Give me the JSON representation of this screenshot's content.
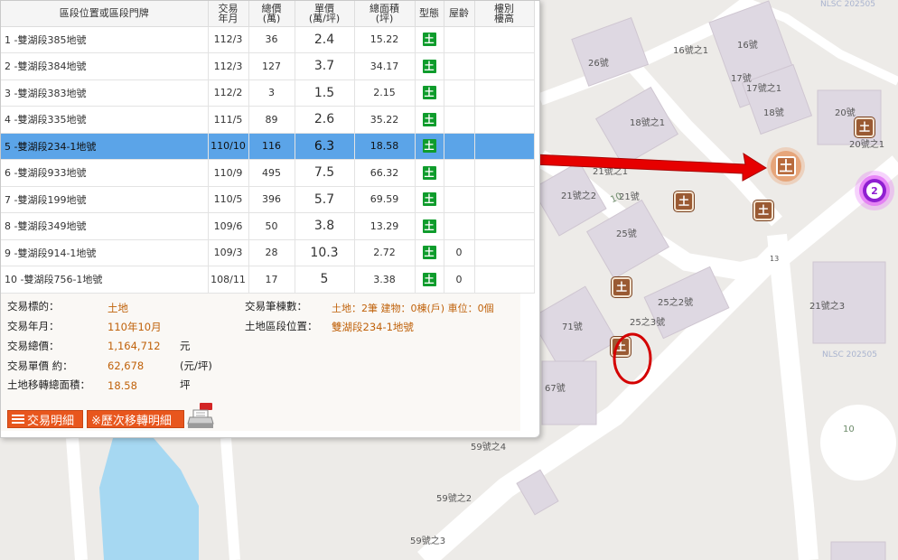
{
  "table": {
    "headers": {
      "addr": "區段位置或區段門牌",
      "date": "交易\n年月",
      "total": "總價\n(萬)",
      "unit": "單價\n(萬/坪)",
      "area": "總面積\n(坪)",
      "type": "型態",
      "age": "屋齡",
      "floor": "樓別\n樓高"
    },
    "rows": [
      {
        "addr": "1 -雙湖段385地號",
        "date": "112/3",
        "total": "36",
        "unit": "2.4",
        "area": "15.22",
        "type": "土",
        "age": ""
      },
      {
        "addr": "2 -雙湖段384地號",
        "date": "112/3",
        "total": "127",
        "unit": "3.7",
        "area": "34.17",
        "type": "土",
        "age": ""
      },
      {
        "addr": "3 -雙湖段383地號",
        "date": "112/2",
        "total": "3",
        "unit": "1.5",
        "area": "2.15",
        "type": "土",
        "age": ""
      },
      {
        "addr": "4 -雙湖段335地號",
        "date": "111/5",
        "total": "89",
        "unit": "2.6",
        "area": "35.22",
        "type": "土",
        "age": ""
      },
      {
        "addr": "5 -雙湖段234-1地號",
        "date": "110/10",
        "total": "116",
        "unit": "6.3",
        "area": "18.58",
        "type": "土",
        "age": ""
      },
      {
        "addr": "6 -雙湖段933地號",
        "date": "110/9",
        "total": "495",
        "unit": "7.5",
        "area": "66.32",
        "type": "土",
        "age": ""
      },
      {
        "addr": "7 -雙湖段199地號",
        "date": "110/5",
        "total": "396",
        "unit": "5.7",
        "area": "69.59",
        "type": "土",
        "age": ""
      },
      {
        "addr": "8 -雙湖段349地號",
        "date": "109/6",
        "total": "50",
        "unit": "3.8",
        "area": "13.29",
        "type": "土",
        "age": ""
      },
      {
        "addr": "9 -雙湖段914-1地號",
        "date": "109/3",
        "total": "28",
        "unit": "10.3",
        "area": "2.72",
        "type": "土",
        "age": "0"
      },
      {
        "addr": "10 -雙湖段756-1地號",
        "date": "108/11",
        "total": "17",
        "unit": "5",
        "area": "3.38",
        "type": "土",
        "age": "0"
      }
    ]
  },
  "detail": {
    "target_label": "交易標的：",
    "target_value": "土地",
    "month_label": "交易年月：",
    "month_value": "110年10月",
    "total_label": "交易總價：",
    "total_value": "1,164,712",
    "total_unit": "元",
    "unitprice_label": "交易單價 約：",
    "unitprice_value": "62,678",
    "unitprice_unit": "(元/坪)",
    "area_label": "土地移轉總面積：",
    "area_value": "18.58",
    "area_unit": "坪",
    "count_label": "交易筆棟數：",
    "count_value": "土地：2筆 建物：0棟(戶) 車位：0個",
    "location_label": "土地區段位置：",
    "location_value": "雙湖段234-1地號"
  },
  "buttons": {
    "detail": "交易明細",
    "history": "※歷次移轉明細"
  },
  "map": {
    "watermark": "NLSC 202505",
    "marker_char": "土",
    "cluster_count": "2",
    "labels": [
      "16號之1",
      "16號",
      "26號",
      "17號",
      "17號之1",
      "18號",
      "18號之1",
      "20號",
      "20號之1",
      "21號之1",
      "21號之2",
      "21號",
      "10",
      "25號",
      "13",
      "25之2號",
      "25之3號",
      "21號之3",
      "71號",
      "67號",
      "59號之4",
      "59號之2",
      "59號之3",
      "10"
    ]
  },
  "colors": {
    "selected_row": "#5ba4e8",
    "land_icon": "#0f9c2c",
    "accent_button": "#e8561d",
    "value_text": "#c0620b",
    "cluster": "#8f1fd1",
    "arrow": "#e60000",
    "highlight_circle": "#d40000"
  }
}
